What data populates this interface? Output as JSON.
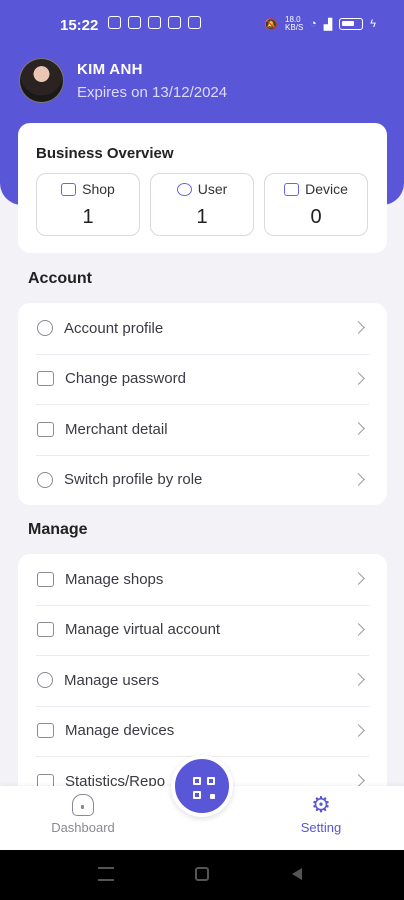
{
  "status_bar": {
    "time": "15:22",
    "network": "18.0 KB/S",
    "battery": "61"
  },
  "profile": {
    "name": "KIM  ANH",
    "expiry": "Expires on 13/12/2024"
  },
  "overview": {
    "title": "Business Overview",
    "stats": [
      {
        "label": "Shop",
        "value": "1",
        "icon": "store-icon"
      },
      {
        "label": "User",
        "value": "1",
        "icon": "users-icon"
      },
      {
        "label": "Device",
        "value": "0",
        "icon": "devices-icon"
      }
    ]
  },
  "account": {
    "title": "Account",
    "items": [
      {
        "label": "Account profile",
        "icon": "user-circle-icon"
      },
      {
        "label": "Change password",
        "icon": "lock-icon"
      },
      {
        "label": "Merchant detail",
        "icon": "bank-icon"
      },
      {
        "label": "Switch profile by role",
        "icon": "switch-user-icon"
      }
    ]
  },
  "manage": {
    "title": "Manage",
    "items": [
      {
        "label": "Manage shops",
        "icon": "store-icon"
      },
      {
        "label": "Manage virtual account",
        "icon": "card-icon"
      },
      {
        "label": "Manage users",
        "icon": "users-icon"
      },
      {
        "label": "Manage devices",
        "icon": "devices-icon"
      },
      {
        "label": "Statistics/Repo",
        "icon": "chart-icon"
      }
    ]
  },
  "tabs": {
    "dashboard": "Dashboard",
    "setting": "Setting"
  },
  "colors": {
    "primary": "#5a56d8",
    "background": "#f2f2f7"
  }
}
